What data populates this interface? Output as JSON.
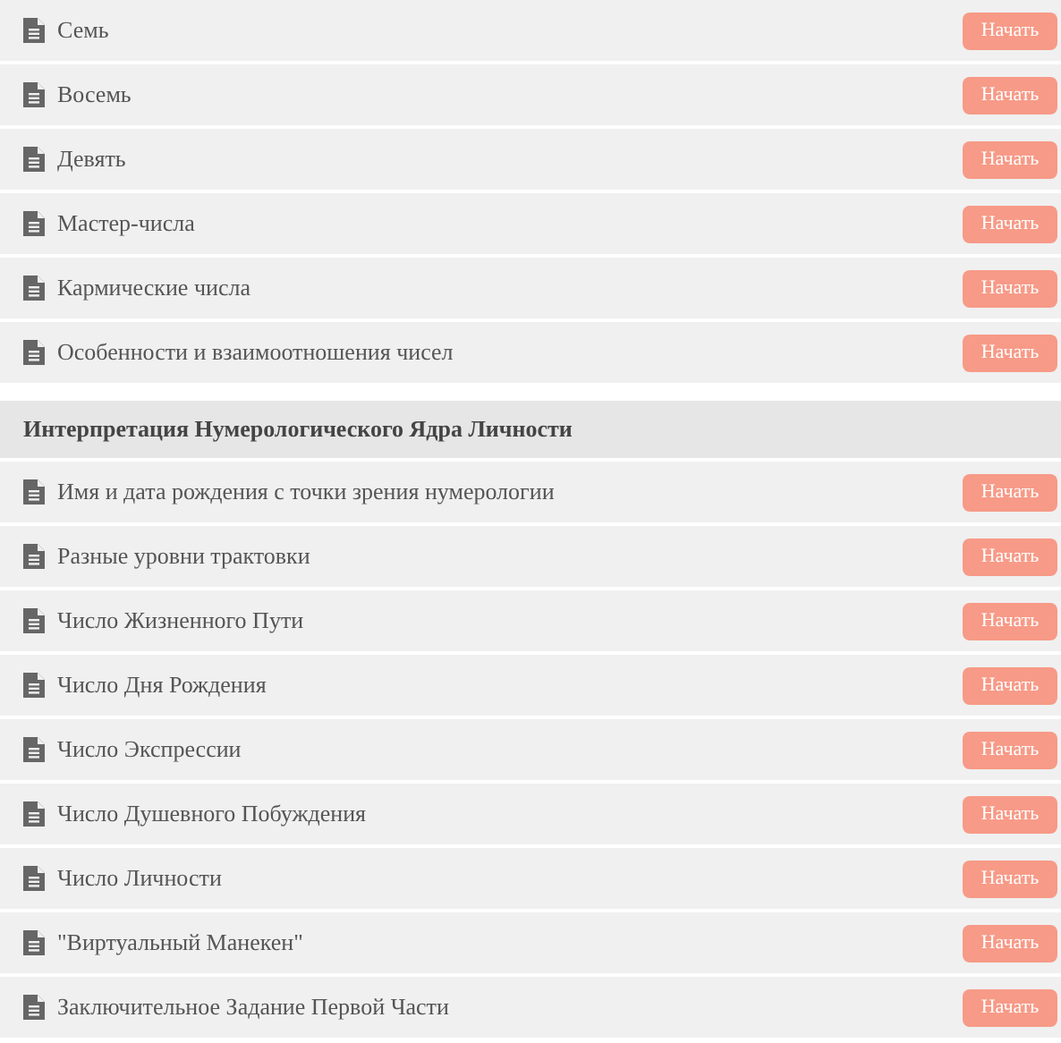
{
  "sections": [
    {
      "lessons": [
        {
          "title": "Семь",
          "button": "Начать"
        },
        {
          "title": "Восемь",
          "button": "Начать"
        },
        {
          "title": "Девять",
          "button": "Начать"
        },
        {
          "title": "Мастер-числа",
          "button": "Начать"
        },
        {
          "title": "Кармические числа",
          "button": "Начать"
        },
        {
          "title": "Особенности и взаимоотношения чисел",
          "button": "Начать"
        }
      ]
    },
    {
      "heading": "Интерпретация Нумерологического Ядра Личности",
      "lessons": [
        {
          "title": "Имя и дата рождения с точки зрения нумерологии",
          "button": "Начать"
        },
        {
          "title": "Разные уровни трактовки",
          "button": "Начать"
        },
        {
          "title": "Число Жизненного Пути",
          "button": "Начать"
        },
        {
          "title": "Число Дня Рождения",
          "button": "Начать"
        },
        {
          "title": "Число Экспрессии",
          "button": "Начать"
        },
        {
          "title": "Число Душевного Побуждения",
          "button": "Начать"
        },
        {
          "title": "Число Личности",
          "button": "Начать"
        },
        {
          "title": "\"Виртуальный Манекен\"",
          "button": "Начать"
        },
        {
          "title": "Заключительное Задание Первой Части",
          "button": "Начать"
        }
      ]
    }
  ]
}
